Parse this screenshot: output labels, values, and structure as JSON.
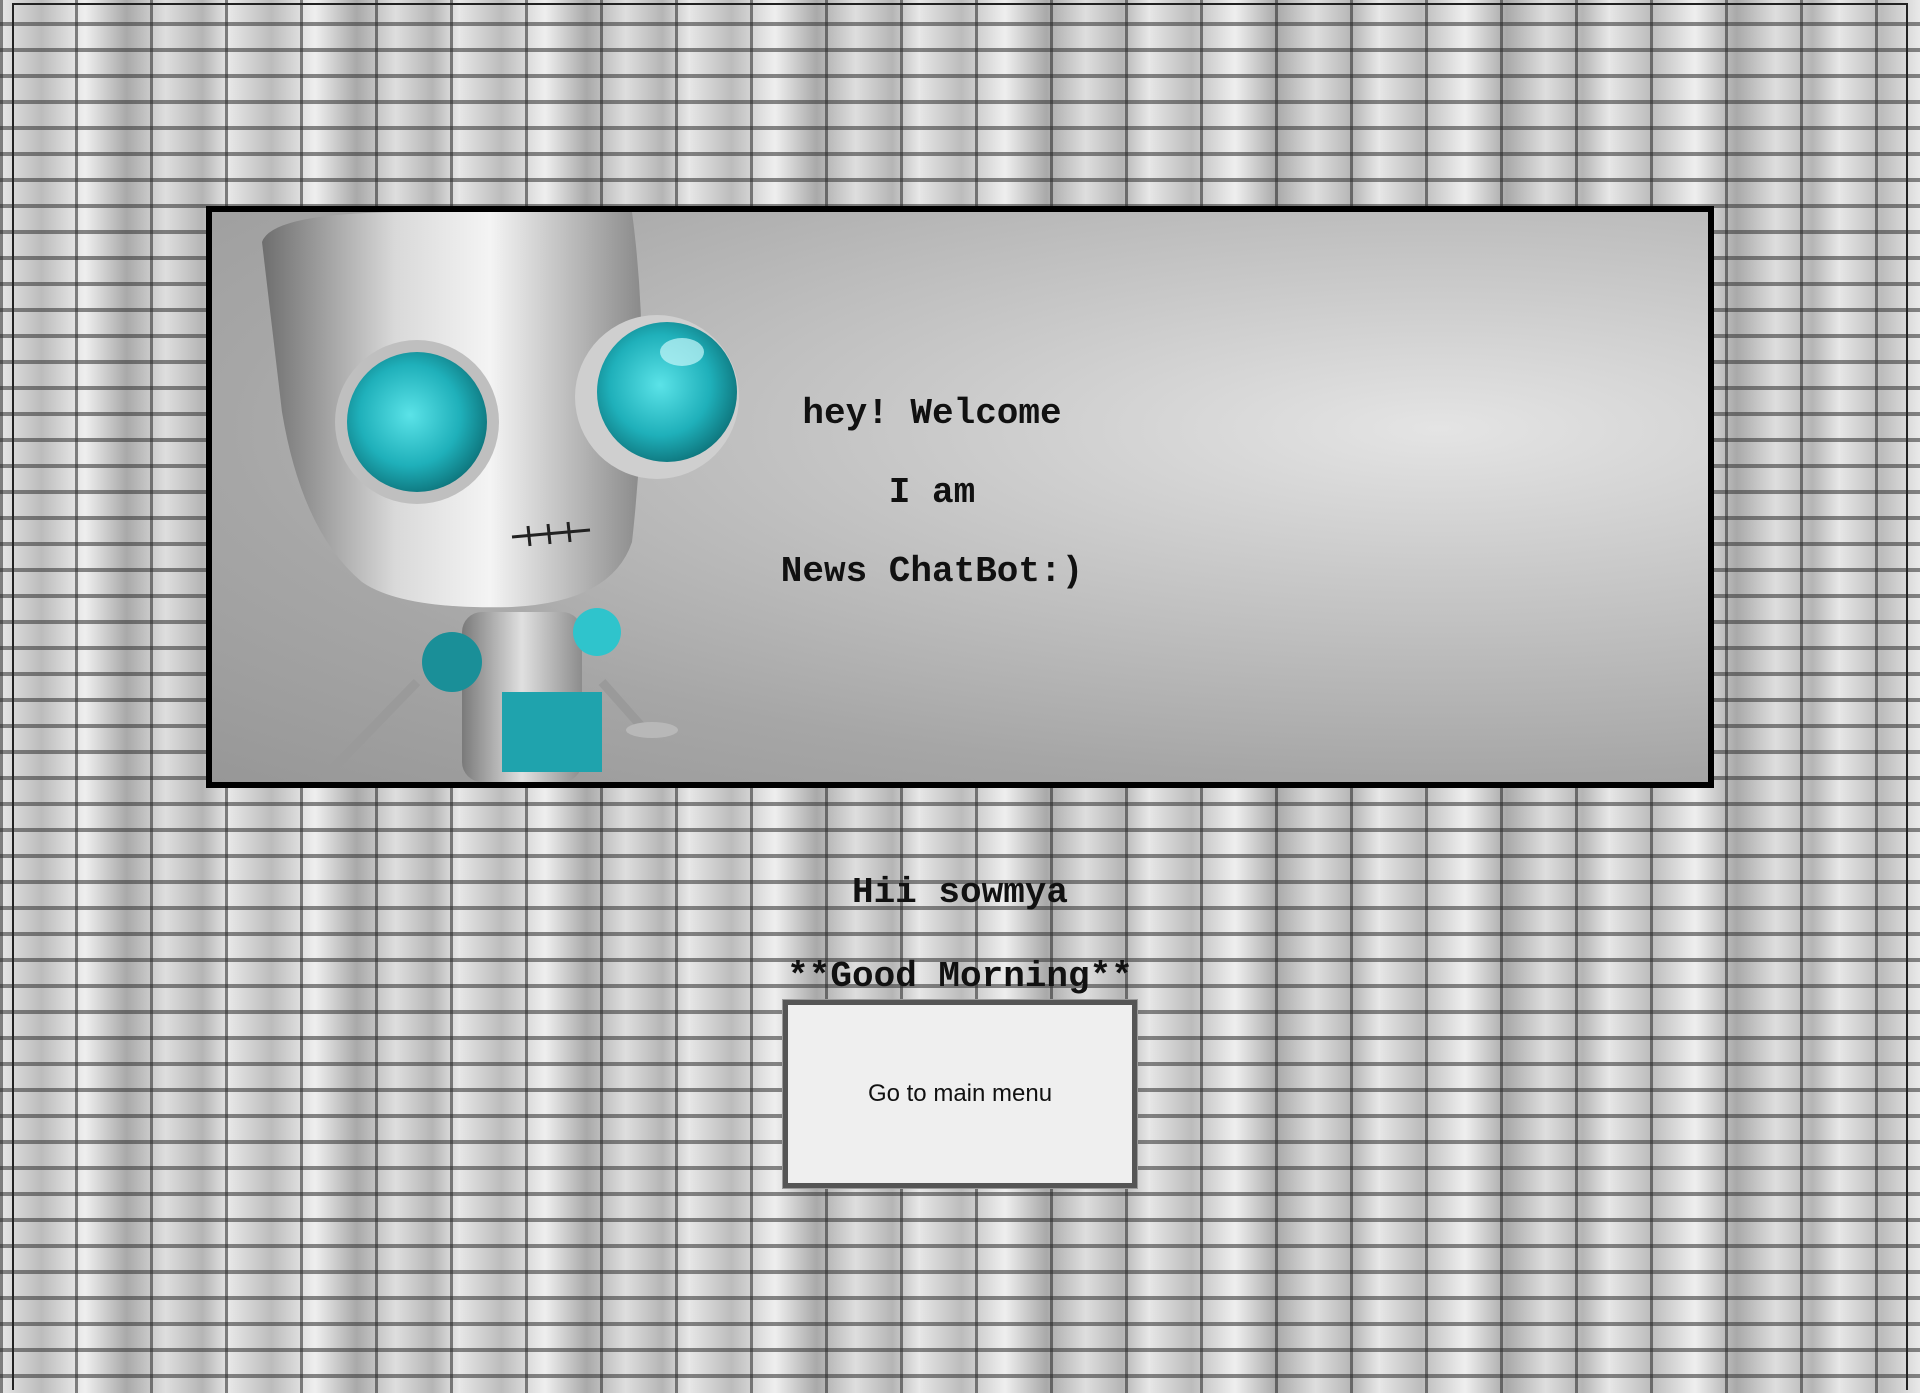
{
  "banner": {
    "illustration": "robot-icon",
    "lines": [
      "hey! Welcome",
      "I am",
      "News ChatBot:)"
    ]
  },
  "greeting": {
    "name_line": "Hii sowmya",
    "time_line": "**Good Morning**"
  },
  "menu_button": {
    "label": "Go to main menu"
  },
  "colors": {
    "robot_eye": "#2fc4cc",
    "border": "#000000",
    "button_bg": "#efefef"
  }
}
